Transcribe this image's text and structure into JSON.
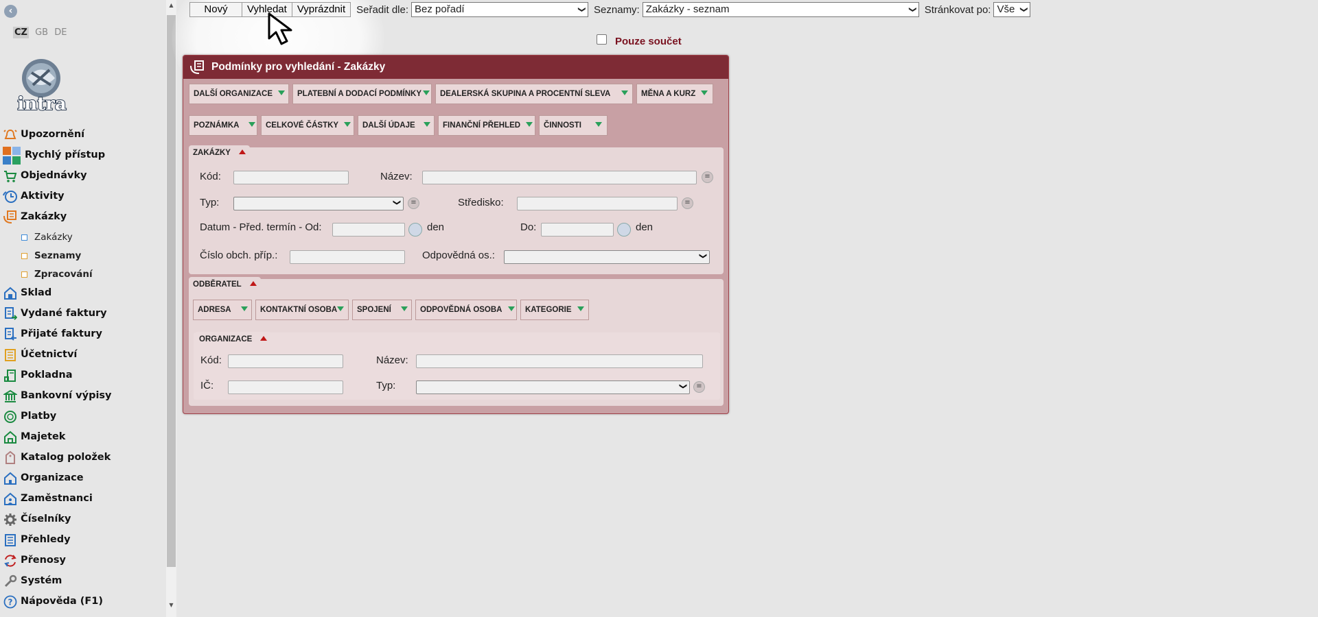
{
  "sidebar": {
    "back_icon": "chevron-left-icon",
    "languages": [
      "CZ",
      "GB",
      "DE"
    ],
    "logo_text": "intra",
    "menu": [
      {
        "label": "Upozornění",
        "icon": "bell-icon"
      },
      {
        "label": "Rychlý přístup",
        "icon": "quick-access-icon"
      },
      {
        "label": "Objednávky",
        "icon": "cart-icon"
      },
      {
        "label": "Aktivity",
        "icon": "clock-icon"
      },
      {
        "label": "Zakázky",
        "icon": "order-icon"
      },
      {
        "label": "Sklad",
        "icon": "warehouse-icon"
      },
      {
        "label": "Vydané faktury",
        "icon": "invoice-out-icon"
      },
      {
        "label": "Přijaté faktury",
        "icon": "invoice-in-icon"
      },
      {
        "label": "Účetnictví",
        "icon": "accounting-icon"
      },
      {
        "label": "Pokladna",
        "icon": "cash-icon"
      },
      {
        "label": "Bankovní výpisy",
        "icon": "bank-icon"
      },
      {
        "label": "Platby",
        "icon": "payment-icon"
      },
      {
        "label": "Majetek",
        "icon": "assets-icon"
      },
      {
        "label": "Katalog položek",
        "icon": "tag-icon"
      },
      {
        "label": "Organizace",
        "icon": "house-icon"
      },
      {
        "label": "Zaměstnanci",
        "icon": "employee-icon"
      },
      {
        "label": "Číselníky",
        "icon": "gear-icon"
      },
      {
        "label": "Přehledy",
        "icon": "list-icon"
      },
      {
        "label": "Přenosy",
        "icon": "sync-icon"
      },
      {
        "label": "Systém",
        "icon": "wrench-icon"
      },
      {
        "label": "Nápověda (F1)",
        "icon": "help-icon"
      }
    ],
    "submenu": [
      "Zakázky",
      "Seznamy",
      "Zpracování"
    ]
  },
  "toolbar": {
    "new_label": "Nový",
    "search_label": "Vyhledat",
    "clear_label": "Vyprázdnit",
    "sort_label": "Seřadit dle:",
    "sort_value": "Bez pořadí",
    "lists_label": "Seznamy:",
    "lists_value": "Zakázky - seznam",
    "paging_label": "Stránkovat po:",
    "paging_value": "Vše"
  },
  "sum_only_label": "Pouze součet",
  "panel": {
    "title": "Podmínky pro vyhledání - Zakázky",
    "tabs_row1": [
      "DALŠÍ ORGANIZACE",
      "PLATEBNÍ A DODACÍ PODMÍNKY",
      "DEALERSKÁ SKUPINA A PROCENTNÍ SLEVA",
      "MĚNA A KURZ"
    ],
    "tabs_row2": [
      "POZNÁMKA",
      "CELKOVÉ ČÁSTKY",
      "DALŠÍ ÚDAJE",
      "FINANČNÍ PŘEHLED",
      "ČINNOSTI"
    ],
    "zakazky": {
      "title": "ZAKÁZKY",
      "kod": "Kód:",
      "nazev": "Název:",
      "typ": "Typ:",
      "stredisko": "Středisko:",
      "datum": "Datum - Před. termín - Od:",
      "den1": "den",
      "do": "Do:",
      "den2": "den",
      "cislo": "Číslo obch. příp.:",
      "odpovedna": "Odpovědná os.:"
    },
    "odberatel": {
      "title": "ODBĚRATEL",
      "tabs": [
        "ADRESA",
        "KONTAKTNÍ OSOBA",
        "SPOJENÍ",
        "ODPOVĚDNÁ OSOBA",
        "KATEGORIE"
      ]
    },
    "organizace": {
      "title": "ORGANIZACE",
      "kod": "Kód:",
      "nazev": "Název:",
      "ic": "IČ:",
      "typ": "Typ:"
    }
  }
}
